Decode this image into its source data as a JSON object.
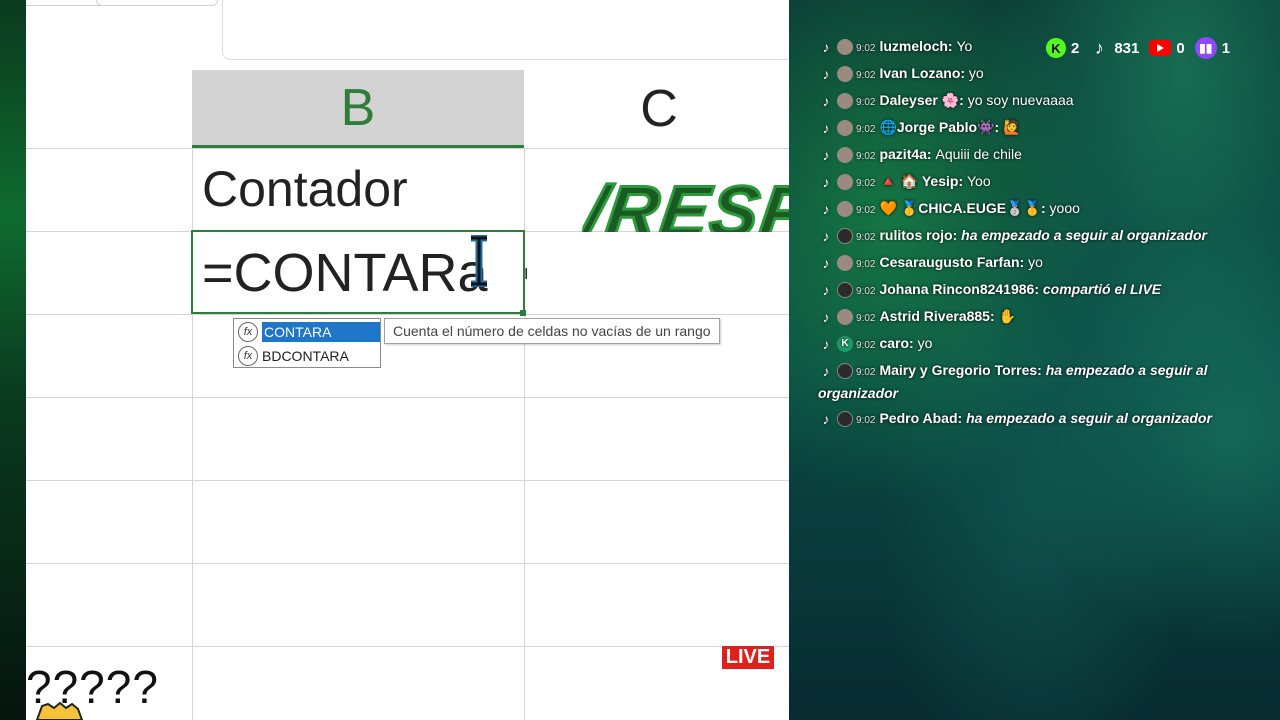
{
  "excel": {
    "columns": {
      "a": "",
      "b": "B",
      "c": "C"
    },
    "cell_b1": "Contador",
    "cell_c1_overlay": "/RESP",
    "formula": "=CONTARa",
    "autocomplete": {
      "items": [
        {
          "icon": "fx-icon",
          "label": "CONTARA",
          "selected": true
        },
        {
          "icon": "fx-icon",
          "label": "BDCONTARA",
          "selected": false
        }
      ],
      "tooltip": "Cuenta el número de celdas no vacías de un rango"
    },
    "question_text": "?????"
  },
  "live_badge": "LIVE",
  "counters": {
    "kick": {
      "icon": "kick-icon",
      "value": "2"
    },
    "tiktok": {
      "icon": "tiktok-icon",
      "value": "831"
    },
    "youtube": {
      "icon": "youtube-icon",
      "value": "0"
    },
    "twitch": {
      "icon": "twitch-icon",
      "value": "1"
    }
  },
  "chat": [
    {
      "time": "9:02",
      "user": "luzmeloch:",
      "text": "Yo",
      "italic": false
    },
    {
      "time": "9:02",
      "user": "Ivan Lozano:",
      "text": "yo",
      "italic": false
    },
    {
      "time": "9:02",
      "user": "Daleyser 🌸:",
      "text": "yo soy nuevaaaa",
      "italic": false
    },
    {
      "time": "9:02",
      "user": "🌐Jorge Pablo👾:",
      "text": "🙋",
      "italic": false
    },
    {
      "time": "9:02",
      "user": "pazit4a:",
      "text": "Aquiii de chile",
      "italic": false
    },
    {
      "time": "9:02",
      "user": "🔺 🏠  Yesip:",
      "text": "Yoo",
      "italic": false
    },
    {
      "time": "9:02",
      "user": "🧡  🥇CHICA.EUGE🥈🥇:",
      "text": "yooo",
      "italic": false
    },
    {
      "time": "9:02",
      "user": "rulitos rojo:",
      "text": "ha empezado a seguir al organizador",
      "italic": true
    },
    {
      "time": "9:02",
      "user": "Cesaraugusto Farfan:",
      "text": "yo",
      "italic": false
    },
    {
      "time": "9:02",
      "user": "Johana Rincon8241986:",
      "text": "compartió el LIVE",
      "italic": true
    },
    {
      "time": "9:02",
      "user": "Astrid Rivera885:",
      "text": "✋",
      "italic": false
    },
    {
      "time": "9:02",
      "user": "caro:",
      "text": "yo",
      "italic": false
    },
    {
      "time": "9:02",
      "user": "Mairy y Gregorio Torres:",
      "text": "ha empezado a seguir al organizador",
      "italic": true
    },
    {
      "time": "9:02",
      "user": "Pedro Abad:",
      "text": "ha empezado a seguir al organizador",
      "italic": true
    }
  ]
}
